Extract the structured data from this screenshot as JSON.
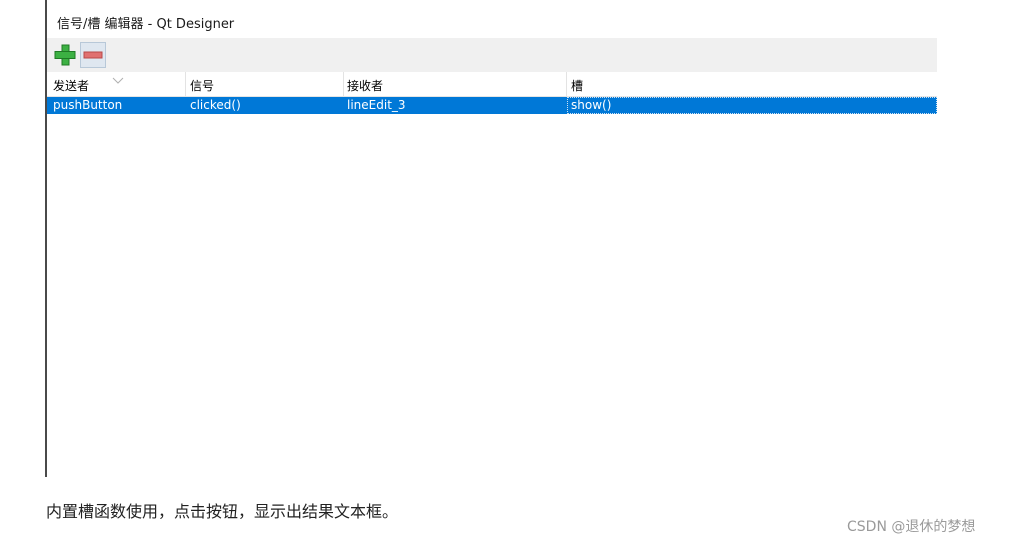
{
  "window": {
    "title": "信号/槽 编辑器 - Qt Designer"
  },
  "toolbar": {
    "add_icon": "plus-icon",
    "remove_icon": "minus-icon",
    "colors": {
      "add": "#3cb043",
      "remove": "#e07070",
      "selection": "#0078d7"
    }
  },
  "table": {
    "columns": [
      "发送者",
      "信号",
      "接收者",
      "槽"
    ],
    "rows": [
      {
        "sender": "pushButton",
        "signal": "clicked()",
        "receiver": "lineEdit_3",
        "slot": "show()",
        "selected": true
      }
    ]
  },
  "caption": "内置槽函数使用，点击按钮，显示出结果文本框。",
  "watermark": "CSDN @退休的梦想"
}
